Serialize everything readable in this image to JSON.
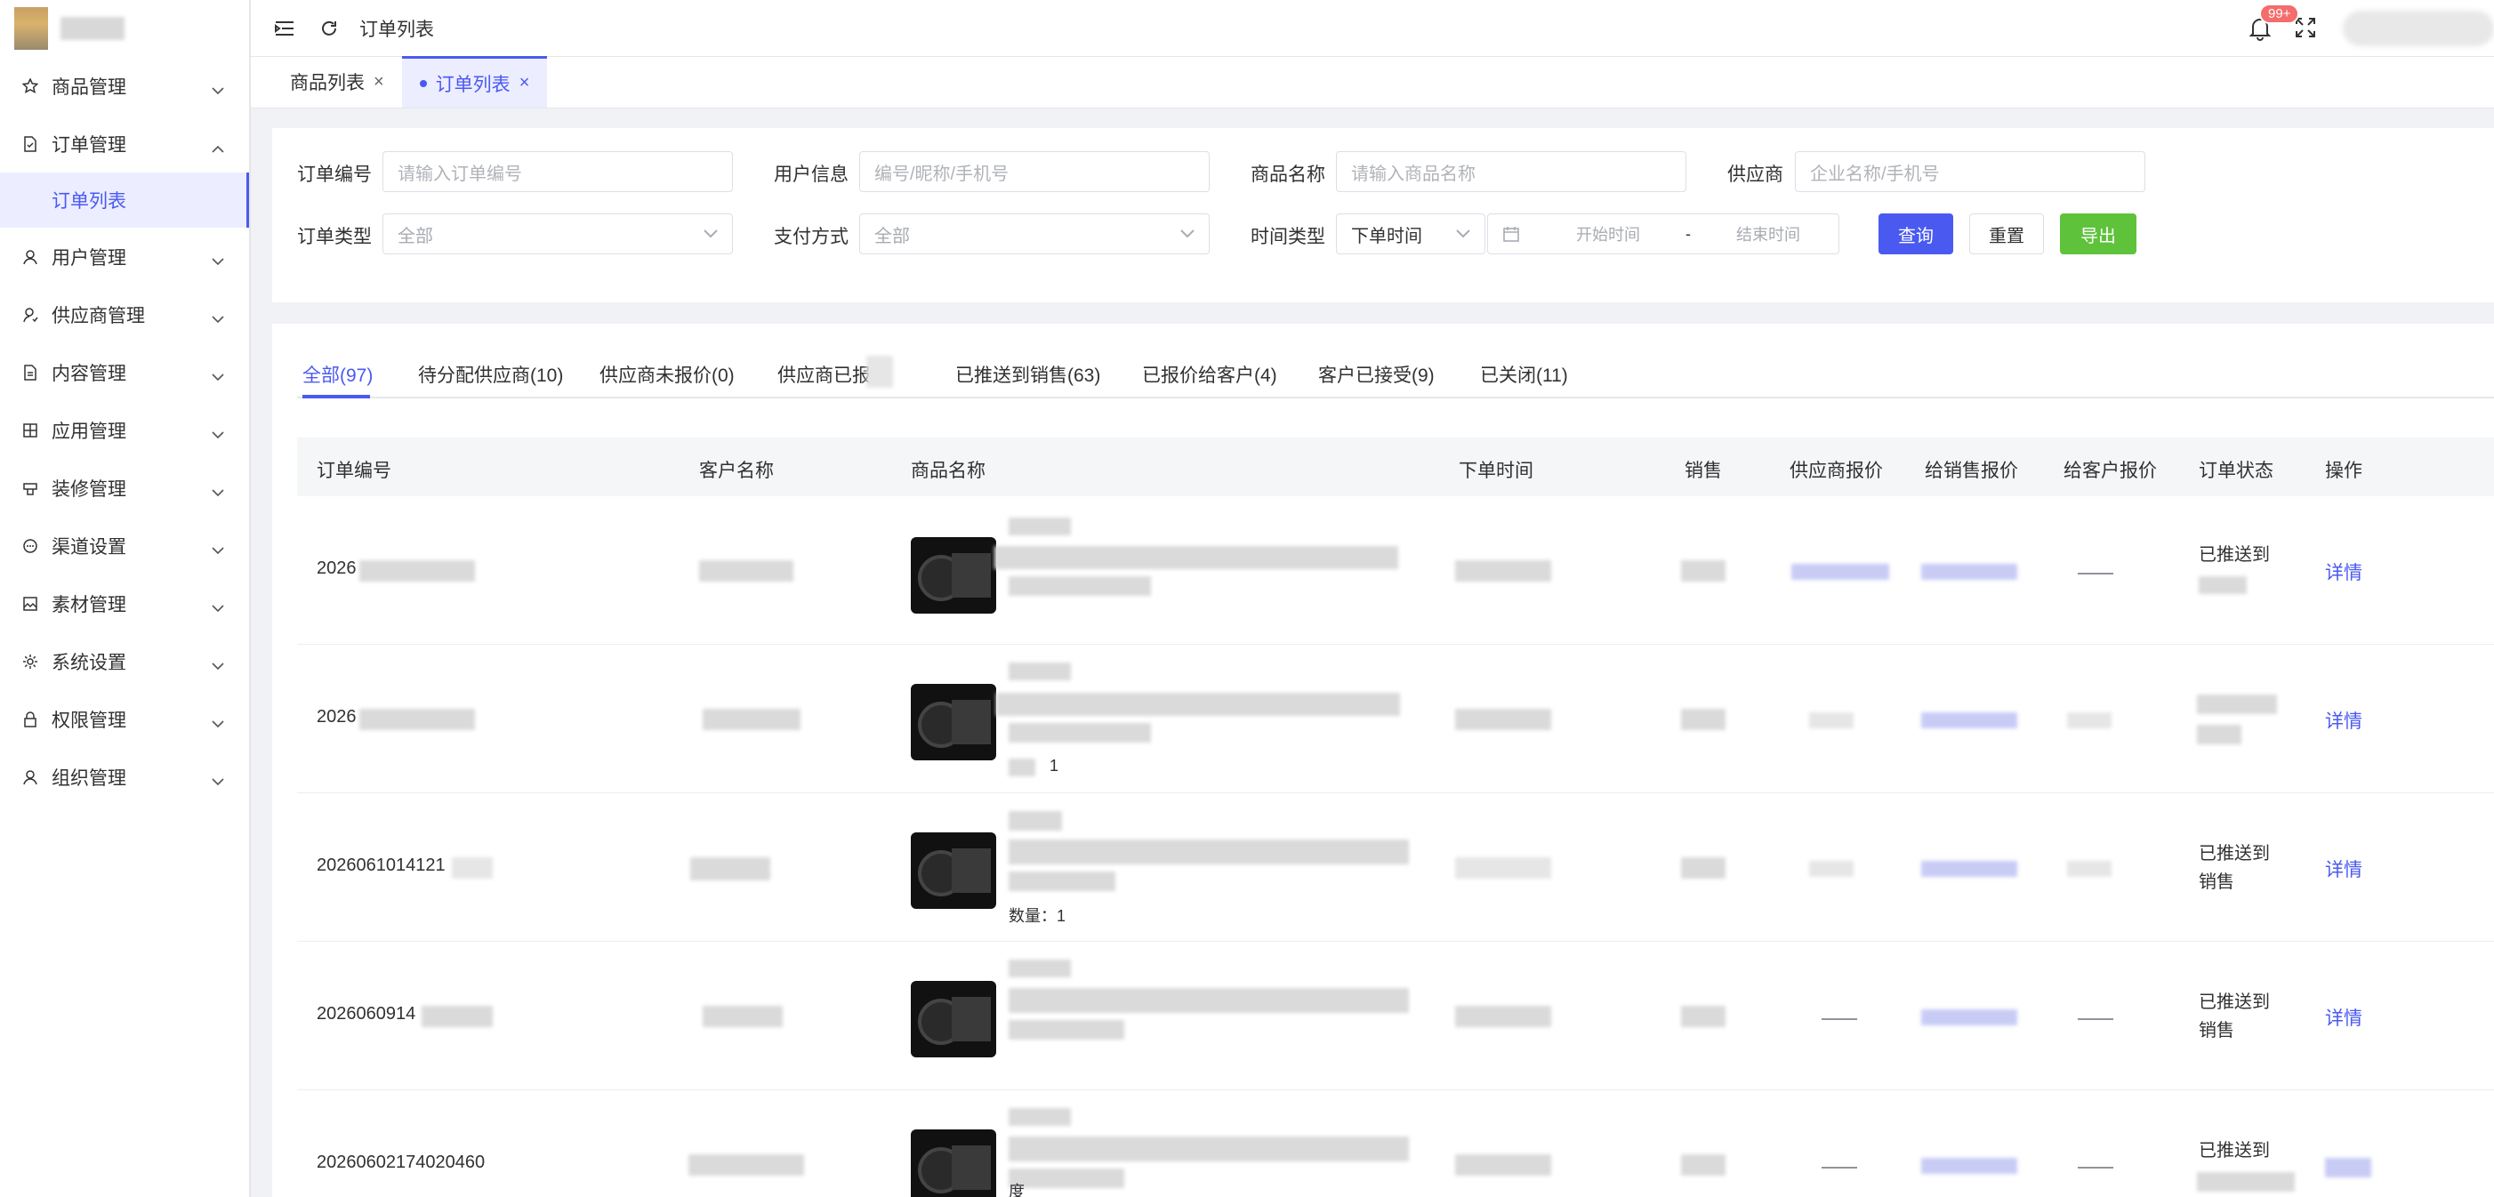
{
  "sidebar": {
    "items": [
      {
        "label": "商品管理",
        "icon": "star-icon"
      },
      {
        "label": "订单管理",
        "icon": "document-icon"
      },
      {
        "label": "用户管理",
        "icon": "user-icon"
      },
      {
        "label": "供应商管理",
        "icon": "supplier-icon"
      },
      {
        "label": "内容管理",
        "icon": "file-icon"
      },
      {
        "label": "应用管理",
        "icon": "grid-icon"
      },
      {
        "label": "装修管理",
        "icon": "decor-icon"
      },
      {
        "label": "渠道设置",
        "icon": "chat-icon"
      },
      {
        "label": "素材管理",
        "icon": "image-icon"
      },
      {
        "label": "系统设置",
        "icon": "gear-icon"
      },
      {
        "label": "权限管理",
        "icon": "lock-icon"
      },
      {
        "label": "组织管理",
        "icon": "org-user-icon"
      }
    ],
    "sub_item": "订单列表"
  },
  "header": {
    "breadcrumb": "订单列表",
    "badge": "99+"
  },
  "tags": [
    {
      "label": "商品列表"
    },
    {
      "label": "订单列表"
    }
  ],
  "filter": {
    "order_no_label": "订单编号",
    "order_no_placeholder": "请输入订单编号",
    "user_label": "用户信息",
    "user_placeholder": "编号/昵称/手机号",
    "product_label": "商品名称",
    "product_placeholder": "请输入商品名称",
    "supplier_label": "供应商",
    "supplier_placeholder": "企业名称/手机号",
    "order_type_label": "订单类型",
    "order_type_value": "全部",
    "pay_label": "支付方式",
    "pay_value": "全部",
    "time_type_label": "时间类型",
    "time_type_value": "下单时间",
    "start_placeholder": "开始时间",
    "range_sep": "-",
    "end_placeholder": "结束时间",
    "query_btn": "查询",
    "reset_btn": "重置",
    "export_btn": "导出"
  },
  "status_tabs": [
    "全部(97)",
    "待分配供应商(10)",
    "供应商未报价(0)",
    "供应商已报",
    "已推送到销售(63)",
    "已报价给客户(4)",
    "客户已接受(9)",
    "已关闭(11)"
  ],
  "table": {
    "headers": [
      "订单编号",
      "客户名称",
      "商品名称",
      "下单时间",
      "销售",
      "供应商报价",
      "给销售报价",
      "给客户报价",
      "订单状态",
      "操作"
    ],
    "rows": [
      {
        "order_no": "2026",
        "qty": "",
        "status": "已推送到",
        "action": "详情"
      },
      {
        "order_no": "2026",
        "qty": "1",
        "status": "",
        "action": "详情"
      },
      {
        "order_no": "2026061014121",
        "qty": "数量：1",
        "status": "已推送到\n销售",
        "action": "详情"
      },
      {
        "order_no": "2026060914",
        "qty": "",
        "status": "已推送到\n销售",
        "action": "详情"
      },
      {
        "order_no": "20260602174020460",
        "qty": "度",
        "status": "已推送到",
        "action": ""
      }
    ]
  }
}
